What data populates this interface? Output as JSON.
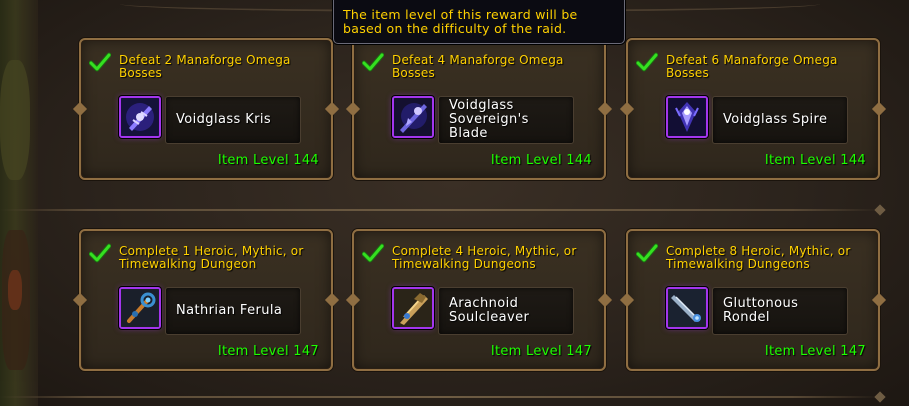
{
  "tooltip": {
    "text": "The item level of this reward will be based on the difficulty of the raid."
  },
  "colors": {
    "objective_gold": "#ffd100",
    "item_level_green": "#1eff00",
    "epic_purple": "#a335ee",
    "card_border": "#8f6e42"
  },
  "raid_rewards": [
    {
      "objective": "Defeat 2 Manaforge Omega Bosses",
      "item": "Voidglass Kris",
      "item_level": "Item Level 144",
      "completed": true,
      "icon": "void-dagger-icon"
    },
    {
      "objective": "Defeat 4 Manaforge Omega Bosses",
      "item": "Voidglass Sovereign's Blade",
      "item_level": "Item Level 144",
      "completed": true,
      "icon": "void-sword-icon"
    },
    {
      "objective": "Defeat 6 Manaforge Omega Bosses",
      "item": "Voidglass Spire",
      "item_level": "Item Level 144",
      "completed": true,
      "icon": "void-staff-icon"
    }
  ],
  "dungeon_rewards": [
    {
      "objective": "Complete 1 Heroic, Mythic, or Timewalking Dungeon",
      "item": "Nathrian Ferula",
      "item_level": "Item Level 147",
      "completed": true,
      "icon": "wand-icon"
    },
    {
      "objective": "Complete 4 Heroic, Mythic, or Timewalking Dungeons",
      "item": "Arachnoid Soulcleaver",
      "item_level": "Item Level 147",
      "completed": true,
      "icon": "cleaver-icon"
    },
    {
      "objective": "Complete 8 Heroic, Mythic, or Timewalking Dungeons",
      "item": "Gluttonous Rondel",
      "item_level": "Item Level 147",
      "completed": true,
      "icon": "rondel-dagger-icon"
    }
  ]
}
